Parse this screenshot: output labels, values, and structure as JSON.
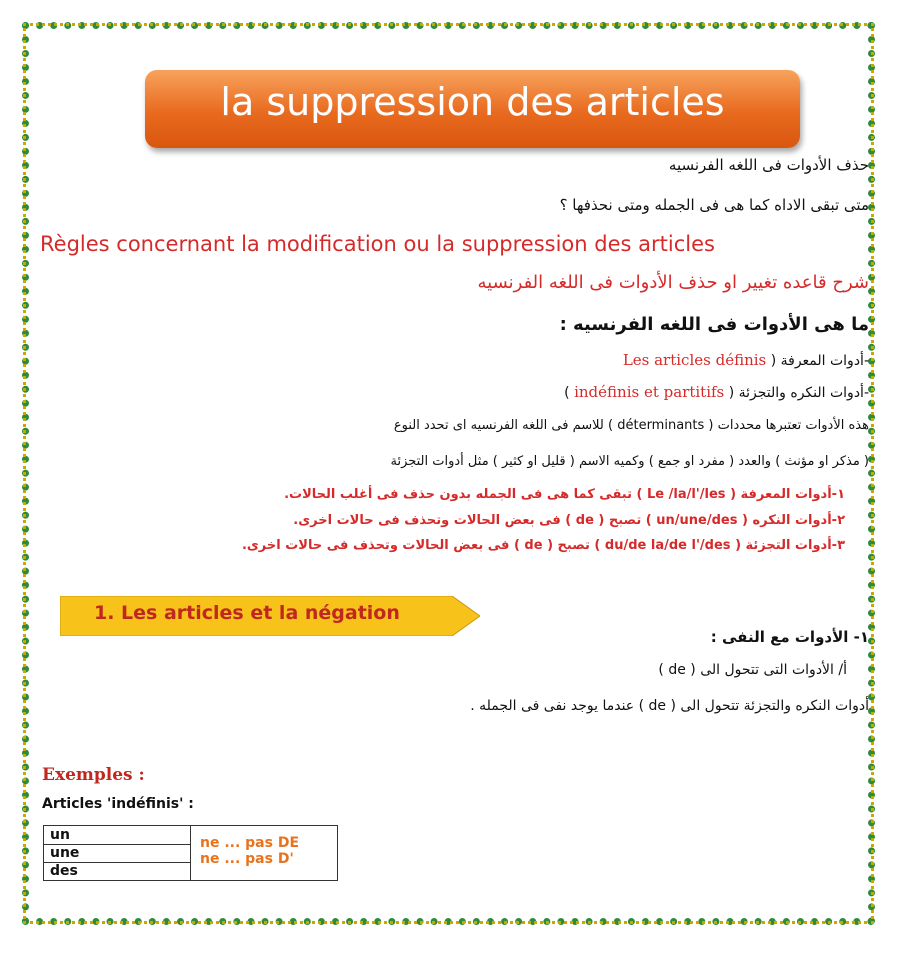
{
  "banner": {
    "title": "la suppression des articles"
  },
  "intro": {
    "line1": "حذف الأدوات فى اللغه الفرنسيه",
    "line2": "متى تبقى الاداه كما هى فى الجمله ومتى نحذفها ؟"
  },
  "rule_fr": "Règles concernant la modification ou la suppression des articles",
  "rule_ar": "شرح قاعده تغيير او حذف الأدوات فى اللغه الفرنسيه",
  "question": "ما هى الأدوات فى اللغه الفرنسيه :",
  "list": {
    "item1_ar": "-أدوات المعرفة (",
    "item1_fr": "Les articles définis",
    "item2_ar": "-أدوات النكره والتجزئة (",
    "item2_fr": "indéfinis  et partitifs",
    "item2_close": ")",
    "desc1": "هذه الأدوات تعتبرها محددات ( déterminants ) للاسم فى اللغه الفرنسيه اى تحدد النوع",
    "desc2": "( مذكر او مؤنث ) والعدد ( مفرد او جمع ) وكميه الاسم ( قليل او كثير ) مثل أدوات التجزئة"
  },
  "rules": {
    "r1": "١-أدوات المعرفة ( Le /la/l'/les ) تبقى كما هى  فى الجمله بدون حذف فى أغلب الحالات.",
    "r2": "٢-أدوات النكره ( un/une/des ) تصبح ( de ) فى بعض الحالات وتحذف فى حالات اخرى.",
    "r3": "٣-أدوات التجزئة ( du/de la/de l'/des ) تصبح ( de ) فى بعض الحالات وتحذف فى حالات اخرى."
  },
  "section1": {
    "label": "1. Les articles et la négation"
  },
  "negation": {
    "title": "١- الأدوات مع النفى :",
    "sub": "أ/ الأدوات التى تتحول الى (  de )",
    "body": "أدوات النكره والتجزئة تتحول الى (  de ) عندما يوجد نفى فى الجمله ."
  },
  "examples": {
    "title": "Exemples :",
    "subtitle": "Articles 'indéfinis' :",
    "col1": [
      "un",
      "une",
      "des"
    ],
    "col2": [
      "ne ... pas DE",
      "ne ... pas D'"
    ]
  },
  "colors": {
    "accent_red": "#d62a2a",
    "banner_orange": "#e86a1f",
    "arrow_yellow": "#f7c21a",
    "border_green": "#2e8b3a"
  }
}
